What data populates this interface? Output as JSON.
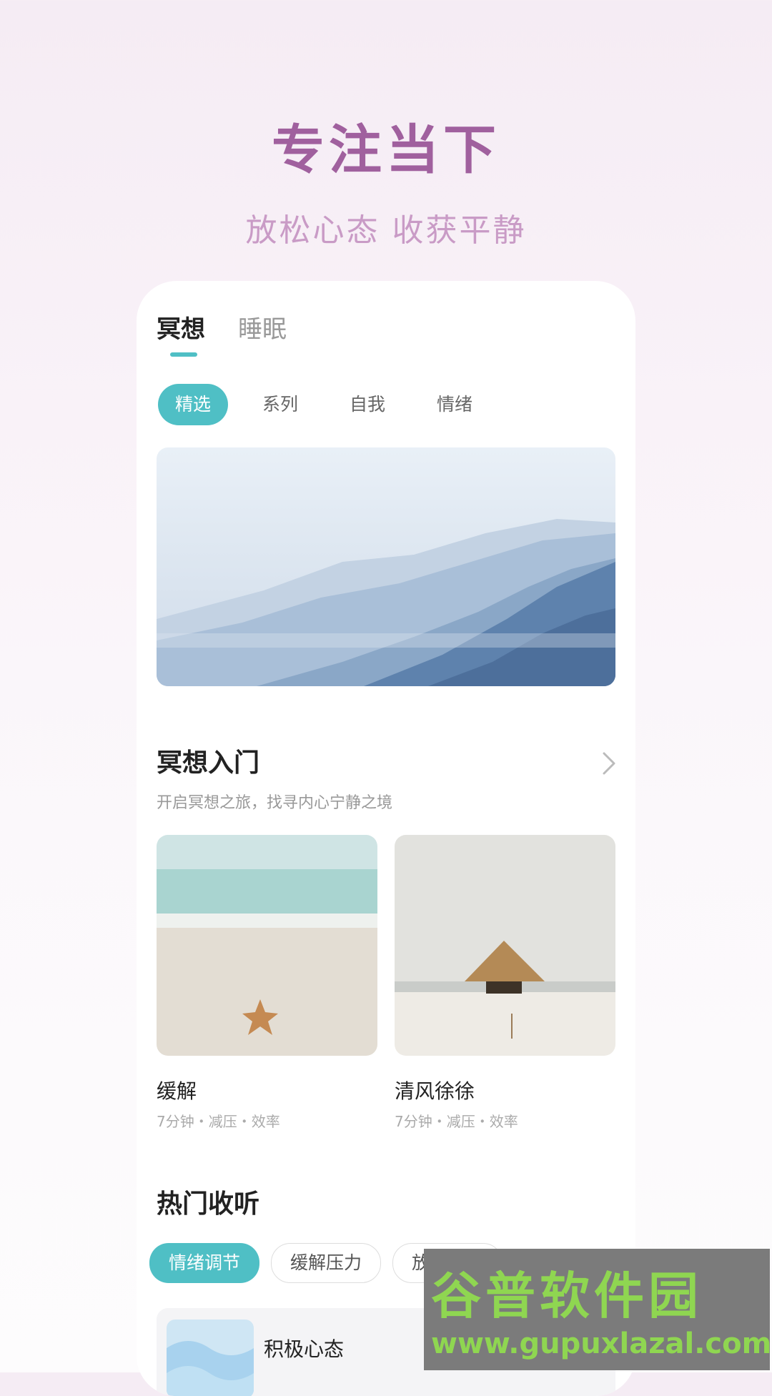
{
  "colors": {
    "accent": "#4fbfc5",
    "hero_title": "#a0609e",
    "hero_sub": "#c99bc6",
    "watermark_text": "#8fd651"
  },
  "hero": {
    "title": "专注当下",
    "subtitle": "放松心态 收获平静"
  },
  "tabs": [
    {
      "label": "冥想",
      "active": true
    },
    {
      "label": "睡眠",
      "active": false
    }
  ],
  "categories": [
    {
      "label": "精选",
      "active": true
    },
    {
      "label": "系列",
      "active": false
    },
    {
      "label": "自我",
      "active": false
    },
    {
      "label": "情绪",
      "active": false
    }
  ],
  "banner": {
    "image": "misty-mountains"
  },
  "intro_section": {
    "title": "冥想入门",
    "subtitle": "开启冥想之旅，找寻内心宁静之境",
    "more_icon": "chevron-right-icon",
    "cards": [
      {
        "title": "缓解",
        "meta": "7分钟・减压・效率",
        "image": "starfish-beach"
      },
      {
        "title": "清风徐徐",
        "meta": "7分钟・减压・效率",
        "image": "straw-hut-beach"
      }
    ]
  },
  "hot_section": {
    "title": "热门收听",
    "chips": [
      {
        "label": "情绪调节",
        "active": true
      },
      {
        "label": "缓解压力",
        "active": false
      },
      {
        "label": "放松助眠",
        "active": false
      }
    ],
    "items": [
      {
        "title": "积极心态",
        "image": "water-ripple"
      }
    ]
  },
  "watermark": {
    "line1": "谷普软件园",
    "line2": "www.gupuxlazal.com"
  }
}
